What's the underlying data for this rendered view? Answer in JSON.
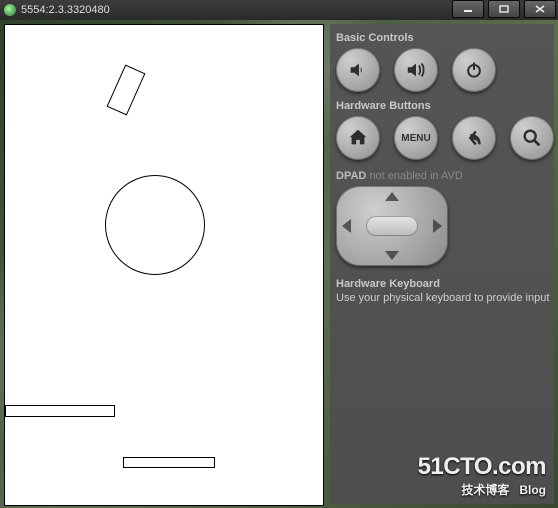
{
  "window": {
    "title": "5554:2.3.3320480"
  },
  "panel": {
    "basic_controls_heading": "Basic Controls",
    "hardware_buttons_heading": "Hardware Buttons",
    "menu_label": "MENU",
    "dpad_label": "DPAD",
    "dpad_status": "not enabled in AVD",
    "hardware_keyboard_heading": "Hardware Keyboard",
    "hardware_keyboard_hint": "Use your physical keyboard to provide input"
  },
  "watermark": {
    "line1": "51CTO.com",
    "line2a": "技术博客",
    "line2b": "Blog"
  }
}
